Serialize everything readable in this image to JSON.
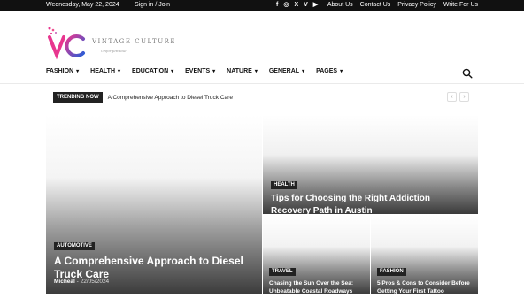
{
  "topbar": {
    "date": "Wednesday, May 22, 2024",
    "signin": "Sign in / Join",
    "socials": [
      "f",
      "◎",
      "X",
      "V",
      "▶"
    ],
    "links": [
      "About Us",
      "Contact Us",
      "Privacy Policy",
      "Write For Us"
    ]
  },
  "logo": {
    "initials": "VC",
    "brand": "VINTAGE CULTURE",
    "tagline": "Unforgettable"
  },
  "nav": {
    "items": [
      {
        "label": "FASHION"
      },
      {
        "label": "HEALTH"
      },
      {
        "label": "EDUCATION"
      },
      {
        "label": "EVENTS"
      },
      {
        "label": "NATURE"
      },
      {
        "label": "GENERAL"
      },
      {
        "label": "PAGES"
      }
    ]
  },
  "trending": {
    "badge": "TRENDING NOW",
    "text": "A Comprehensive Approach to Diesel Truck Care"
  },
  "posts": {
    "main": {
      "category": "AUTOMOTIVE",
      "title": "A Comprehensive Approach to Diesel Truck Care",
      "author": "Micheal",
      "date": "22/05/2024"
    },
    "top": {
      "category": "HEALTH",
      "title": "Tips for Choosing the Right Addiction Recovery Path in Austin"
    },
    "small1": {
      "category": "TRAVEL",
      "title": "Chasing the Sun Over the Sea: Unbeatable Coastal Roadways"
    },
    "small2": {
      "category": "FASHION",
      "title": "5 Pros & Cons to Consider Before Getting Your First Tattoo"
    }
  },
  "colors": {
    "topbar": "#111111",
    "badge": "#222222",
    "logo_pink": "#e8368f",
    "logo_blue": "#2b5cd6"
  }
}
